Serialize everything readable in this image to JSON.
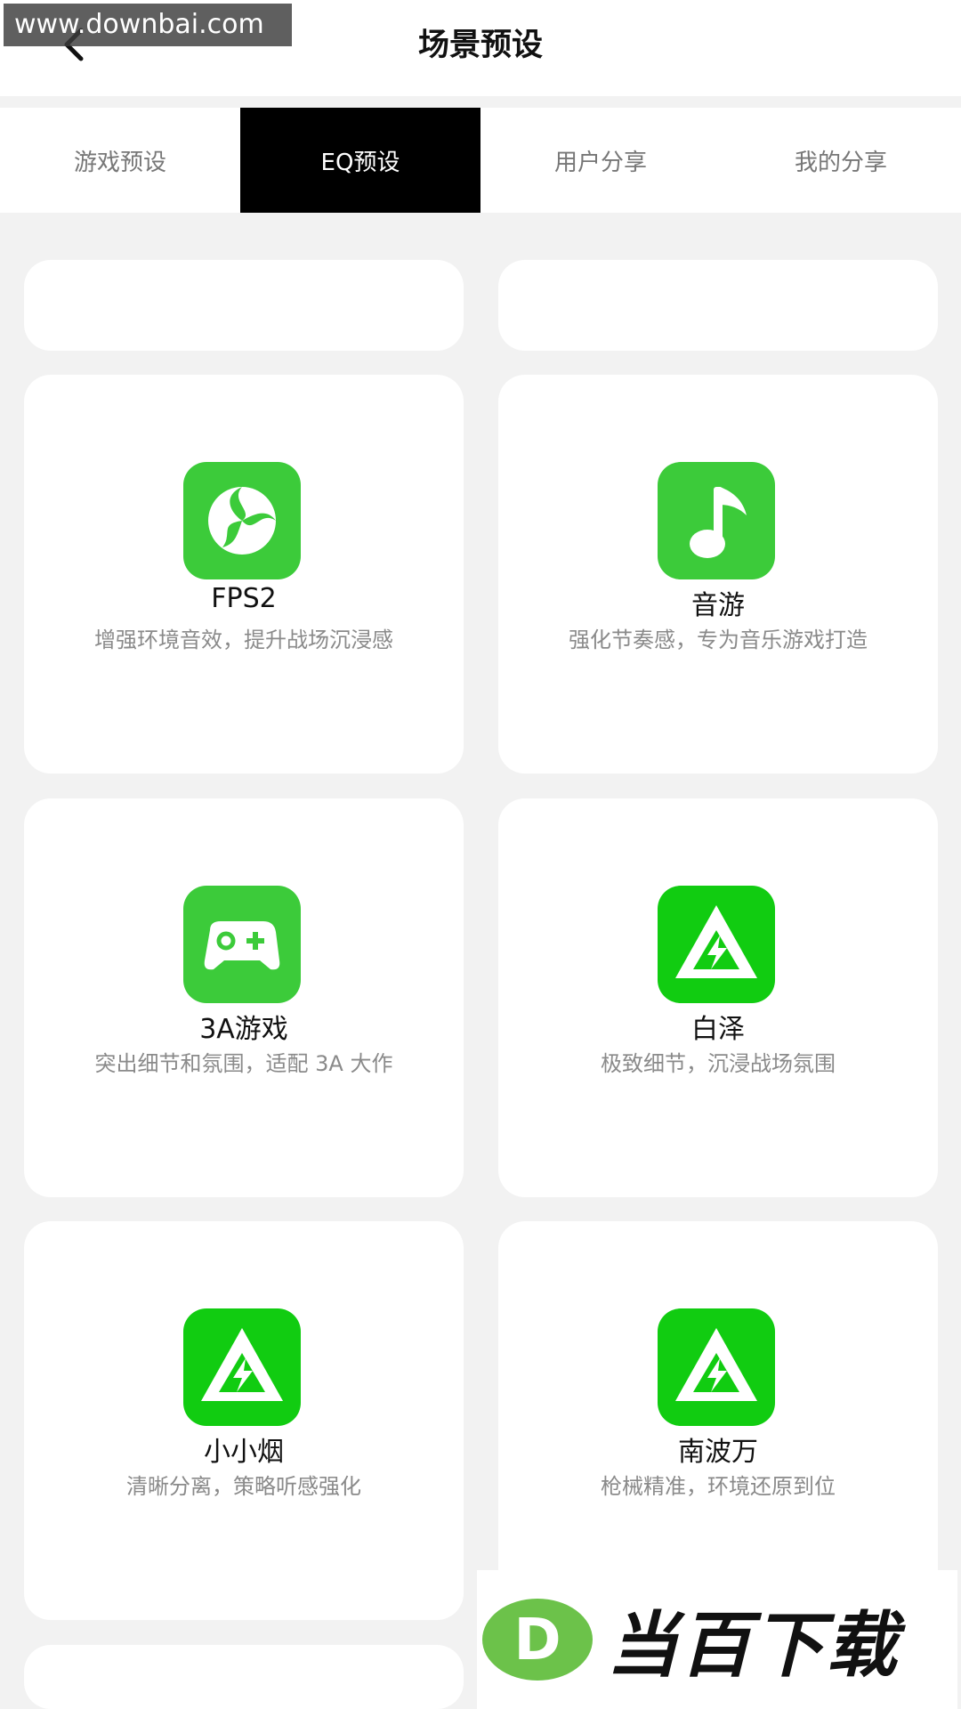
{
  "header": {
    "title": "场景预设",
    "watermark_url": "www.downbai.com"
  },
  "tabs": [
    {
      "label": "游戏预设",
      "active": false
    },
    {
      "label": "EQ预设",
      "active": true
    },
    {
      "label": "用户分享",
      "active": false
    },
    {
      "label": "我的分享",
      "active": false
    }
  ],
  "colors": {
    "accent_green": "#3ccb3a",
    "bright_green": "#11cc11",
    "active_tab_bg": "#000000"
  },
  "presets": [
    {
      "name": "FPS2",
      "description": "增强环境音效，提升战场沉浸感",
      "icon": "fps-swirl-icon"
    },
    {
      "name": "音游",
      "description": "强化节奏感，专为音乐游戏打造",
      "icon": "music-note-icon"
    },
    {
      "name": "3A游戏",
      "description": "突出细节和氛围，适配 3A 大作",
      "icon": "gamepad-icon"
    },
    {
      "name": "白泽",
      "description": "极致细节，沉浸战场氛围",
      "icon": "triangle-bolt-icon"
    },
    {
      "name": "小小烟",
      "description": "清晰分离，策略听感强化",
      "icon": "triangle-bolt-icon"
    },
    {
      "name": "南波万",
      "description": "枪械精准，环境还原到位",
      "icon": "triangle-bolt-icon"
    }
  ],
  "brand": {
    "text": "当百下载",
    "logo_letter": "D"
  }
}
